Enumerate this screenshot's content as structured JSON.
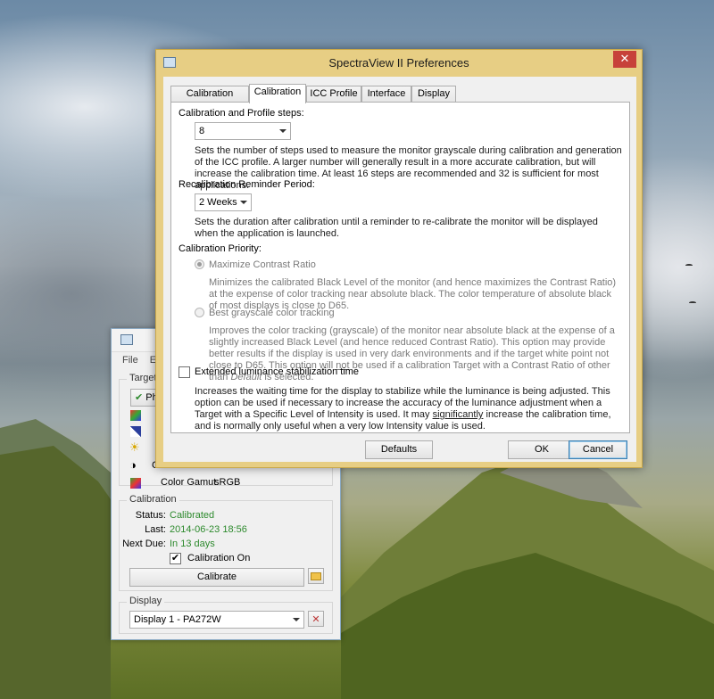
{
  "background_window": {
    "menu": [
      "File",
      "Ed"
    ],
    "target_group_title": "Target S",
    "target_button_label": "Pho",
    "rows": [
      "Cor"
    ],
    "color_gamut_label": "Color Gamut:",
    "color_gamut_value": "sRGB",
    "calibration_group_title": "Calibration",
    "status_label": "Status:",
    "status_value": "Calibrated",
    "last_label": "Last:",
    "last_value": "2014-06-23 18:56",
    "next_due_label": "Next Due:",
    "next_due_value": "In 13 days",
    "calibration_on_label": "Calibration On",
    "calibration_on_checked": "✔",
    "calibrate_button": "Calibrate",
    "display_group_title": "Display",
    "display_select_value": "Display 1 - PA272W"
  },
  "dialog": {
    "title": "SpectraView II Preferences",
    "close_glyph": "✕",
    "tabs": [
      "Calibration Sensor",
      "Calibration",
      "ICC Profile",
      "Interface",
      "Display"
    ],
    "active_tab": "Calibration",
    "steps_label": "Calibration and Profile steps:",
    "steps_value": "8",
    "steps_desc": "Sets the number of steps used to measure the monitor grayscale during calibration and generation of the ICC profile. A larger number will generally result in a more accurate calibration, but will increase the calibration time. At least 16 steps are recommended and 32 is sufficient for most applications.",
    "reminder_label": "Recalibration Reminder Period:",
    "reminder_value": "2 Weeks",
    "reminder_desc": "Sets the duration after calibration until a reminder to re-calibrate the monitor will be displayed when the application is launched.",
    "priority_label": "Calibration Priority:",
    "option1_label": "Maximize Contrast Ratio",
    "option1_desc": "Minimizes the calibrated Black Level of the monitor (and hence maximizes the Contrast Ratio) at the expense of color tracking near absolute black. The color temperature of absolute black of most displays is close to D65.",
    "option2_label": "Best grayscale color tracking",
    "option2_desc_a": "Improves the color tracking (grayscale) of the monitor near absolute black at the expense of a slightly increased Black Level (and hence reduced Contrast Ratio). This option may provide better results if the display is used in very dark environments and if the target white point not close to D65. This option will",
    "option2_desc_not": "not",
    "option2_desc_b": "be used if a calibration Target with a Contrast Ratio of other than",
    "option2_desc_default": "Default",
    "option2_desc_c": "is selected.",
    "extended_label": "Extended luminance stabilization time",
    "extended_desc_a": "Increases the waiting time for the display to stabilize while the luminance is being adjusted. This option can be used if necessary to increase the accuracy of the luminance adjustment when a Target with a Specific Level of Intensity is used. It may",
    "extended_desc_sig": "significantly",
    "extended_desc_b": "increase the calibration time, and is normally only useful when a very low Intensity value is used.",
    "defaults_button": "Defaults",
    "ok_button": "OK",
    "cancel_button": "Cancel"
  },
  "colors": {
    "dialog_frame": "#e7ce84",
    "close_button": "#c7413a",
    "status_green": "#2d8a2d"
  }
}
